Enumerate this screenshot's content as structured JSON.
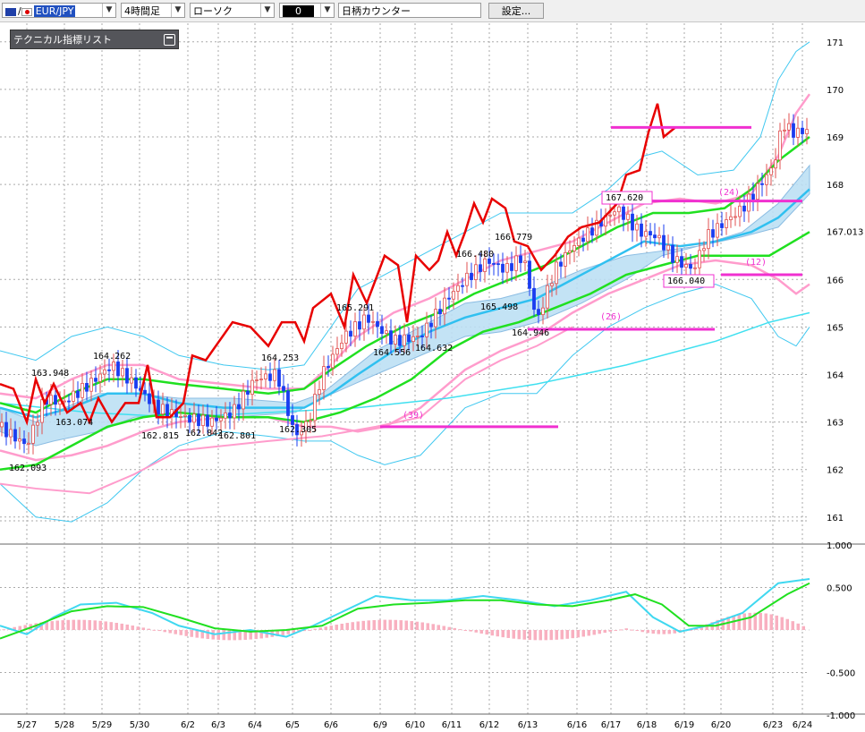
{
  "toolbar": {
    "symbol": "EUR/JPY",
    "timeframe": "4時間足",
    "chart_style": "ローソク",
    "selector": "0",
    "counter": "日柄カウンター",
    "settings_label": "設定..."
  },
  "panel": {
    "title": "テクニカル指標リスト"
  },
  "colors": {
    "candle_up": "#e05050",
    "candle_down": "#1a3cf0",
    "rsi_line": "#e80000",
    "bollinger_inner": "#ff9ccc",
    "bollinger_outer": "#40c8f0",
    "ma_green": "#20e020",
    "ma_blue": "#30c0f0",
    "cloud": "#bde0f5",
    "level_line": "#f030d0",
    "macd_hist": "#f8b0c0"
  },
  "chart_data": {
    "type": "line",
    "instrument": "EUR/JPY",
    "timeframe": "4時間足",
    "y_axis": {
      "ticks": [
        "171",
        "170",
        "169",
        "168",
        "167.013",
        "166",
        "165",
        "164",
        "163",
        "162",
        "161"
      ],
      "range": [
        160.4,
        171.3
      ],
      "current": "167.013"
    },
    "sub_axis": {
      "ticks": [
        "1.000",
        "0.500",
        "-0.500",
        "-1.000"
      ],
      "range": [
        -1.0,
        1.0
      ]
    },
    "x_axis": {
      "ticks": [
        "5/27",
        "5/28",
        "5/29",
        "5/30",
        "6/2",
        "6/3",
        "6/4",
        "6/5",
        "6/6",
        "6/9",
        "6/10",
        "6/11",
        "6/12",
        "6/13",
        "6/16",
        "6/17",
        "6/18",
        "6/19",
        "6/20",
        "6/23",
        "6/24"
      ]
    },
    "price_labels": [
      {
        "text": "163.948",
        "value": 163.948
      },
      {
        "text": "163.074",
        "value": 163.074
      },
      {
        "text": "162.093",
        "value": 162.093
      },
      {
        "text": "164.262",
        "value": 164.262
      },
      {
        "text": "162.815",
        "value": 162.815
      },
      {
        "text": "162.842",
        "value": 162.842
      },
      {
        "text": "162.801",
        "value": 162.801
      },
      {
        "text": "164.253",
        "value": 164.253
      },
      {
        "text": "162.305",
        "value": 162.305
      },
      {
        "text": "165.291",
        "value": 165.291
      },
      {
        "text": "164.556",
        "value": 164.556
      },
      {
        "text": "164.632",
        "value": 164.632
      },
      {
        "text": "166.480",
        "value": 166.48
      },
      {
        "text": "165.498",
        "value": 165.498
      },
      {
        "text": "166.779",
        "value": 166.779
      },
      {
        "text": "164.946",
        "value": 164.946
      },
      {
        "text": "167.620",
        "value": 167.62
      },
      {
        "text": "166.040",
        "value": 166.04
      }
    ],
    "count_labels": [
      "(39)",
      "(26)",
      "(24)",
      "(12)"
    ],
    "levels": [
      {
        "value": 169.2,
        "from": "6/17",
        "to": "6/20"
      },
      {
        "value": 167.65,
        "from": "6/18",
        "to": "6/24"
      },
      {
        "value": 166.1,
        "from": "6/20",
        "to": "6/24"
      },
      {
        "value": 164.95,
        "from": "6/13",
        "to": "6/19"
      },
      {
        "value": 162.9,
        "from": "6/9",
        "to": "6/13"
      }
    ]
  }
}
